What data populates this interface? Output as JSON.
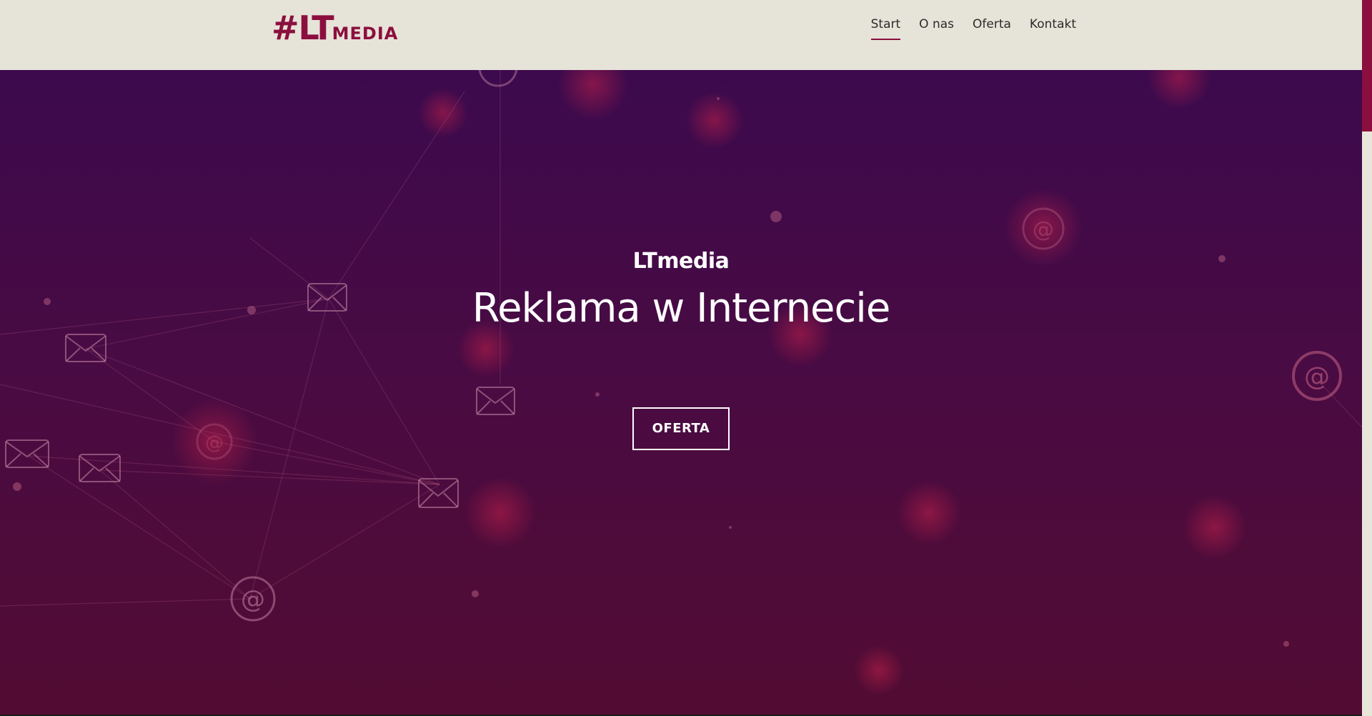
{
  "header": {
    "logo": {
      "hash": "#",
      "lt": "LT",
      "media": "MEDIA"
    },
    "nav": [
      {
        "label": "Start",
        "active": true
      },
      {
        "label": "O nas",
        "active": false
      },
      {
        "label": "Oferta",
        "active": false
      },
      {
        "label": "Kontakt",
        "active": false
      }
    ]
  },
  "hero": {
    "kicker": "LTmedia",
    "title": "Reklama w Internecie",
    "cta_label": "OFERTA"
  },
  "colors": {
    "brand": "#8b0f3e",
    "header_bg": "#e6e3d8",
    "hero_top": "#3c0a4d",
    "hero_bottom": "#520c33"
  },
  "decor_icons": [
    "envelope-icon",
    "at-sign-icon"
  ]
}
